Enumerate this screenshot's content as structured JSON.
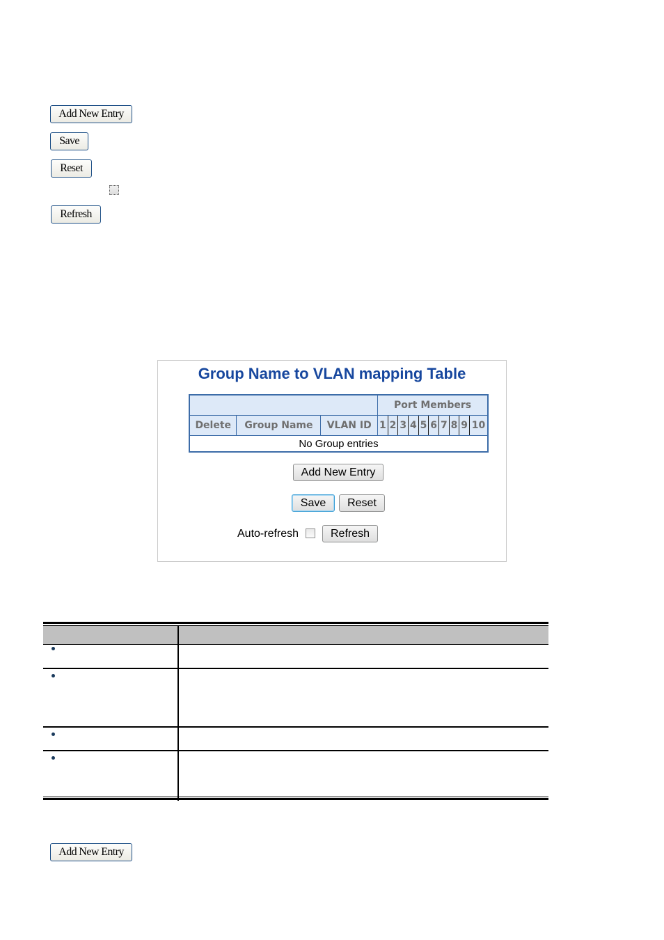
{
  "top_buttons": {
    "add_new_entry": "Add New Entry",
    "save": "Save",
    "reset": "Reset",
    "auto_refresh_checked": false,
    "refresh": "Refresh"
  },
  "panel": {
    "title": "Group Name to VLAN mapping Table",
    "table": {
      "group_header": "Port Members",
      "columns": [
        "Delete",
        "Group Name",
        "VLAN ID"
      ],
      "ports": [
        "1",
        "2",
        "3",
        "4",
        "5",
        "6",
        "7",
        "8",
        "9",
        "10"
      ],
      "empty_message": "No Group entries"
    },
    "add_new_entry": "Add New Entry",
    "save": "Save",
    "reset": "Reset",
    "auto_refresh_label": "Auto-refresh",
    "auto_refresh_checked": false,
    "refresh": "Refresh"
  },
  "description_table": {
    "header": [
      "",
      ""
    ],
    "rows": [
      {
        "object": "",
        "description": ""
      },
      {
        "object": "",
        "description": ""
      },
      {
        "object": "",
        "description": ""
      },
      {
        "object": "",
        "description": ""
      }
    ]
  },
  "bottom_buttons": {
    "add_new_entry": "Add New Entry"
  }
}
